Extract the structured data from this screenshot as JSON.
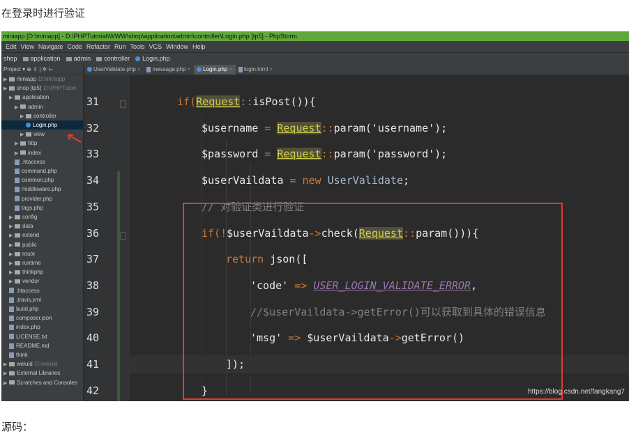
{
  "article": {
    "top_text": "在登录时进行验证",
    "bottom_text": "源码："
  },
  "ide": {
    "title": "miniapp [D:\\miniapp] - D:\\PHPTutorial\\WWW\\shop\\application\\admin\\controller\\Login.php [tp5] - PhpStorm",
    "menu": [
      "Edit",
      "View",
      "Navigate",
      "Code",
      "Refactor",
      "Run",
      "Tools",
      "VCS",
      "Window",
      "Help"
    ],
    "breadcrumbs": [
      "shop",
      "application",
      "admin",
      "controller",
      "Login.php"
    ],
    "project_header": "Project ▾  ⊕ ⇳ | ✲ ⊢",
    "tabs": [
      {
        "label": "UserValidate.php",
        "active": false,
        "icon": "php-class-icon"
      },
      {
        "label": "message.php",
        "active": false,
        "icon": "php-file-icon"
      },
      {
        "label": "Login.php",
        "active": true,
        "icon": "php-class-icon"
      },
      {
        "label": "login.html",
        "active": false,
        "icon": "html-file-icon"
      }
    ],
    "tree": [
      {
        "label": "miniapp",
        "hint": "D:\\miniapp",
        "depth": 0,
        "type": "folder"
      },
      {
        "label": "shop [tp5]",
        "hint": "D:\\PHPTutori",
        "depth": 0,
        "type": "folder"
      },
      {
        "label": "application",
        "depth": 1,
        "type": "folder"
      },
      {
        "label": "admin",
        "depth": 2,
        "type": "folder"
      },
      {
        "label": "controller",
        "depth": 3,
        "type": "folder"
      },
      {
        "label": "Login.php",
        "depth": 4,
        "type": "php",
        "selected": true
      },
      {
        "label": "view",
        "depth": 3,
        "type": "folder"
      },
      {
        "label": "http",
        "depth": 2,
        "type": "folder"
      },
      {
        "label": "index",
        "depth": 2,
        "type": "folder"
      },
      {
        "label": ".htaccess",
        "depth": 2,
        "type": "file"
      },
      {
        "label": "command.php",
        "depth": 2,
        "type": "file"
      },
      {
        "label": "common.php",
        "depth": 2,
        "type": "file"
      },
      {
        "label": "middleware.php",
        "depth": 2,
        "type": "file"
      },
      {
        "label": "provider.php",
        "depth": 2,
        "type": "file"
      },
      {
        "label": "tags.php",
        "depth": 2,
        "type": "file"
      },
      {
        "label": "config",
        "depth": 1,
        "type": "folder"
      },
      {
        "label": "data",
        "depth": 1,
        "type": "folder"
      },
      {
        "label": "extend",
        "depth": 1,
        "type": "folder"
      },
      {
        "label": "public",
        "depth": 1,
        "type": "folder"
      },
      {
        "label": "route",
        "depth": 1,
        "type": "folder"
      },
      {
        "label": "runtime",
        "depth": 1,
        "type": "folder"
      },
      {
        "label": "thinkphp",
        "depth": 1,
        "type": "folder"
      },
      {
        "label": "vendor",
        "depth": 1,
        "type": "folder"
      },
      {
        "label": ".htaccess",
        "depth": 1,
        "type": "file"
      },
      {
        "label": ".travis.yml",
        "depth": 1,
        "type": "file"
      },
      {
        "label": "build.php",
        "depth": 1,
        "type": "file"
      },
      {
        "label": "composer.json",
        "depth": 1,
        "type": "file"
      },
      {
        "label": "index.php",
        "depth": 1,
        "type": "file"
      },
      {
        "label": "LICENSE.txt",
        "depth": 1,
        "type": "file"
      },
      {
        "label": "README.md",
        "depth": 1,
        "type": "file"
      },
      {
        "label": "think",
        "depth": 1,
        "type": "file"
      },
      {
        "label": "weiuid",
        "hint": "D:\\weiuid",
        "depth": 0,
        "type": "folder"
      },
      {
        "label": "External Libraries",
        "depth": 0,
        "type": "lib"
      },
      {
        "label": "Scratches and Consoles",
        "depth": 0,
        "type": "lib"
      }
    ],
    "code": {
      "line_numbers": [
        "31",
        "32",
        "33",
        "34",
        "35",
        "36",
        "37",
        "38",
        "39",
        "40",
        "41",
        "42"
      ],
      "lines": [
        {
          "indent": 0,
          "tokens": [
            [
              "kw",
              "if("
            ],
            [
              "cls",
              "Request"
            ],
            [
              "op",
              "::"
            ],
            [
              "fn",
              "isPost"
            ],
            [
              "plain",
              "()){"
            ]
          ]
        },
        {
          "indent": 1,
          "tokens": [
            [
              "var",
              "$username"
            ],
            [
              "op",
              " = "
            ],
            [
              "cls",
              "Request"
            ],
            [
              "op",
              "::"
            ],
            [
              "fn",
              "param"
            ],
            [
              "plain",
              "("
            ],
            [
              "str-lit",
              "'username'"
            ],
            [
              "plain",
              ");"
            ]
          ]
        },
        {
          "indent": 1,
          "tokens": [
            [
              "var",
              "$password"
            ],
            [
              "op",
              " = "
            ],
            [
              "cls",
              "Request"
            ],
            [
              "op",
              "::"
            ],
            [
              "fn",
              "param"
            ],
            [
              "plain",
              "("
            ],
            [
              "str-lit",
              "'password'"
            ],
            [
              "plain",
              ");"
            ]
          ]
        },
        {
          "indent": 1,
          "tokens": [
            [
              "var",
              "$userVaildata"
            ],
            [
              "op",
              " = "
            ],
            [
              "kw",
              "new "
            ],
            [
              "newcls",
              "UserValidate"
            ],
            [
              "plain",
              ";"
            ]
          ]
        },
        {
          "indent": 1,
          "tokens": [
            [
              "cmt",
              "// 对验证类进行验证"
            ]
          ]
        },
        {
          "indent": 1,
          "tokens": [
            [
              "kw",
              "if(!"
            ],
            [
              "var",
              "$userVaildata"
            ],
            [
              "op",
              "->"
            ],
            [
              "fn",
              "check"
            ],
            [
              "plain",
              "("
            ],
            [
              "cls",
              "Request"
            ],
            [
              "op",
              "::"
            ],
            [
              "fn",
              "param"
            ],
            [
              "plain",
              "())){"
            ]
          ]
        },
        {
          "indent": 2,
          "tokens": [
            [
              "kw",
              "return "
            ],
            [
              "fn",
              "json"
            ],
            [
              "plain",
              "(["
            ]
          ]
        },
        {
          "indent": 3,
          "tokens": [
            [
              "str-lit",
              "'code'"
            ],
            [
              "op",
              " => "
            ],
            [
              "const",
              "USER_LOGIN_VALIDATE_ERROR"
            ],
            [
              "plain",
              ","
            ]
          ]
        },
        {
          "indent": 3,
          "tokens": [
            [
              "cmt",
              "//$userVaildata->getError()可以获取到具体的错误信息"
            ]
          ]
        },
        {
          "indent": 3,
          "tokens": [
            [
              "str-lit",
              "'msg'"
            ],
            [
              "op",
              " => "
            ],
            [
              "var",
              "$userVaildata"
            ],
            [
              "op",
              "->"
            ],
            [
              "fn",
              "getError"
            ],
            [
              "plain",
              "()"
            ]
          ]
        },
        {
          "indent": 2,
          "tokens": [
            [
              "plain",
              "]);"
            ]
          ]
        },
        {
          "indent": 1,
          "tokens": [
            [
              "plain",
              "}"
            ]
          ]
        }
      ]
    },
    "watermark": "https://blog.csdn.net/fangkang7",
    "colors": {
      "title_bar": "#5fa83a",
      "editor_bg": "#2b2b2b",
      "keyword": "#cc7832",
      "highlight_box": "#e53935"
    }
  }
}
